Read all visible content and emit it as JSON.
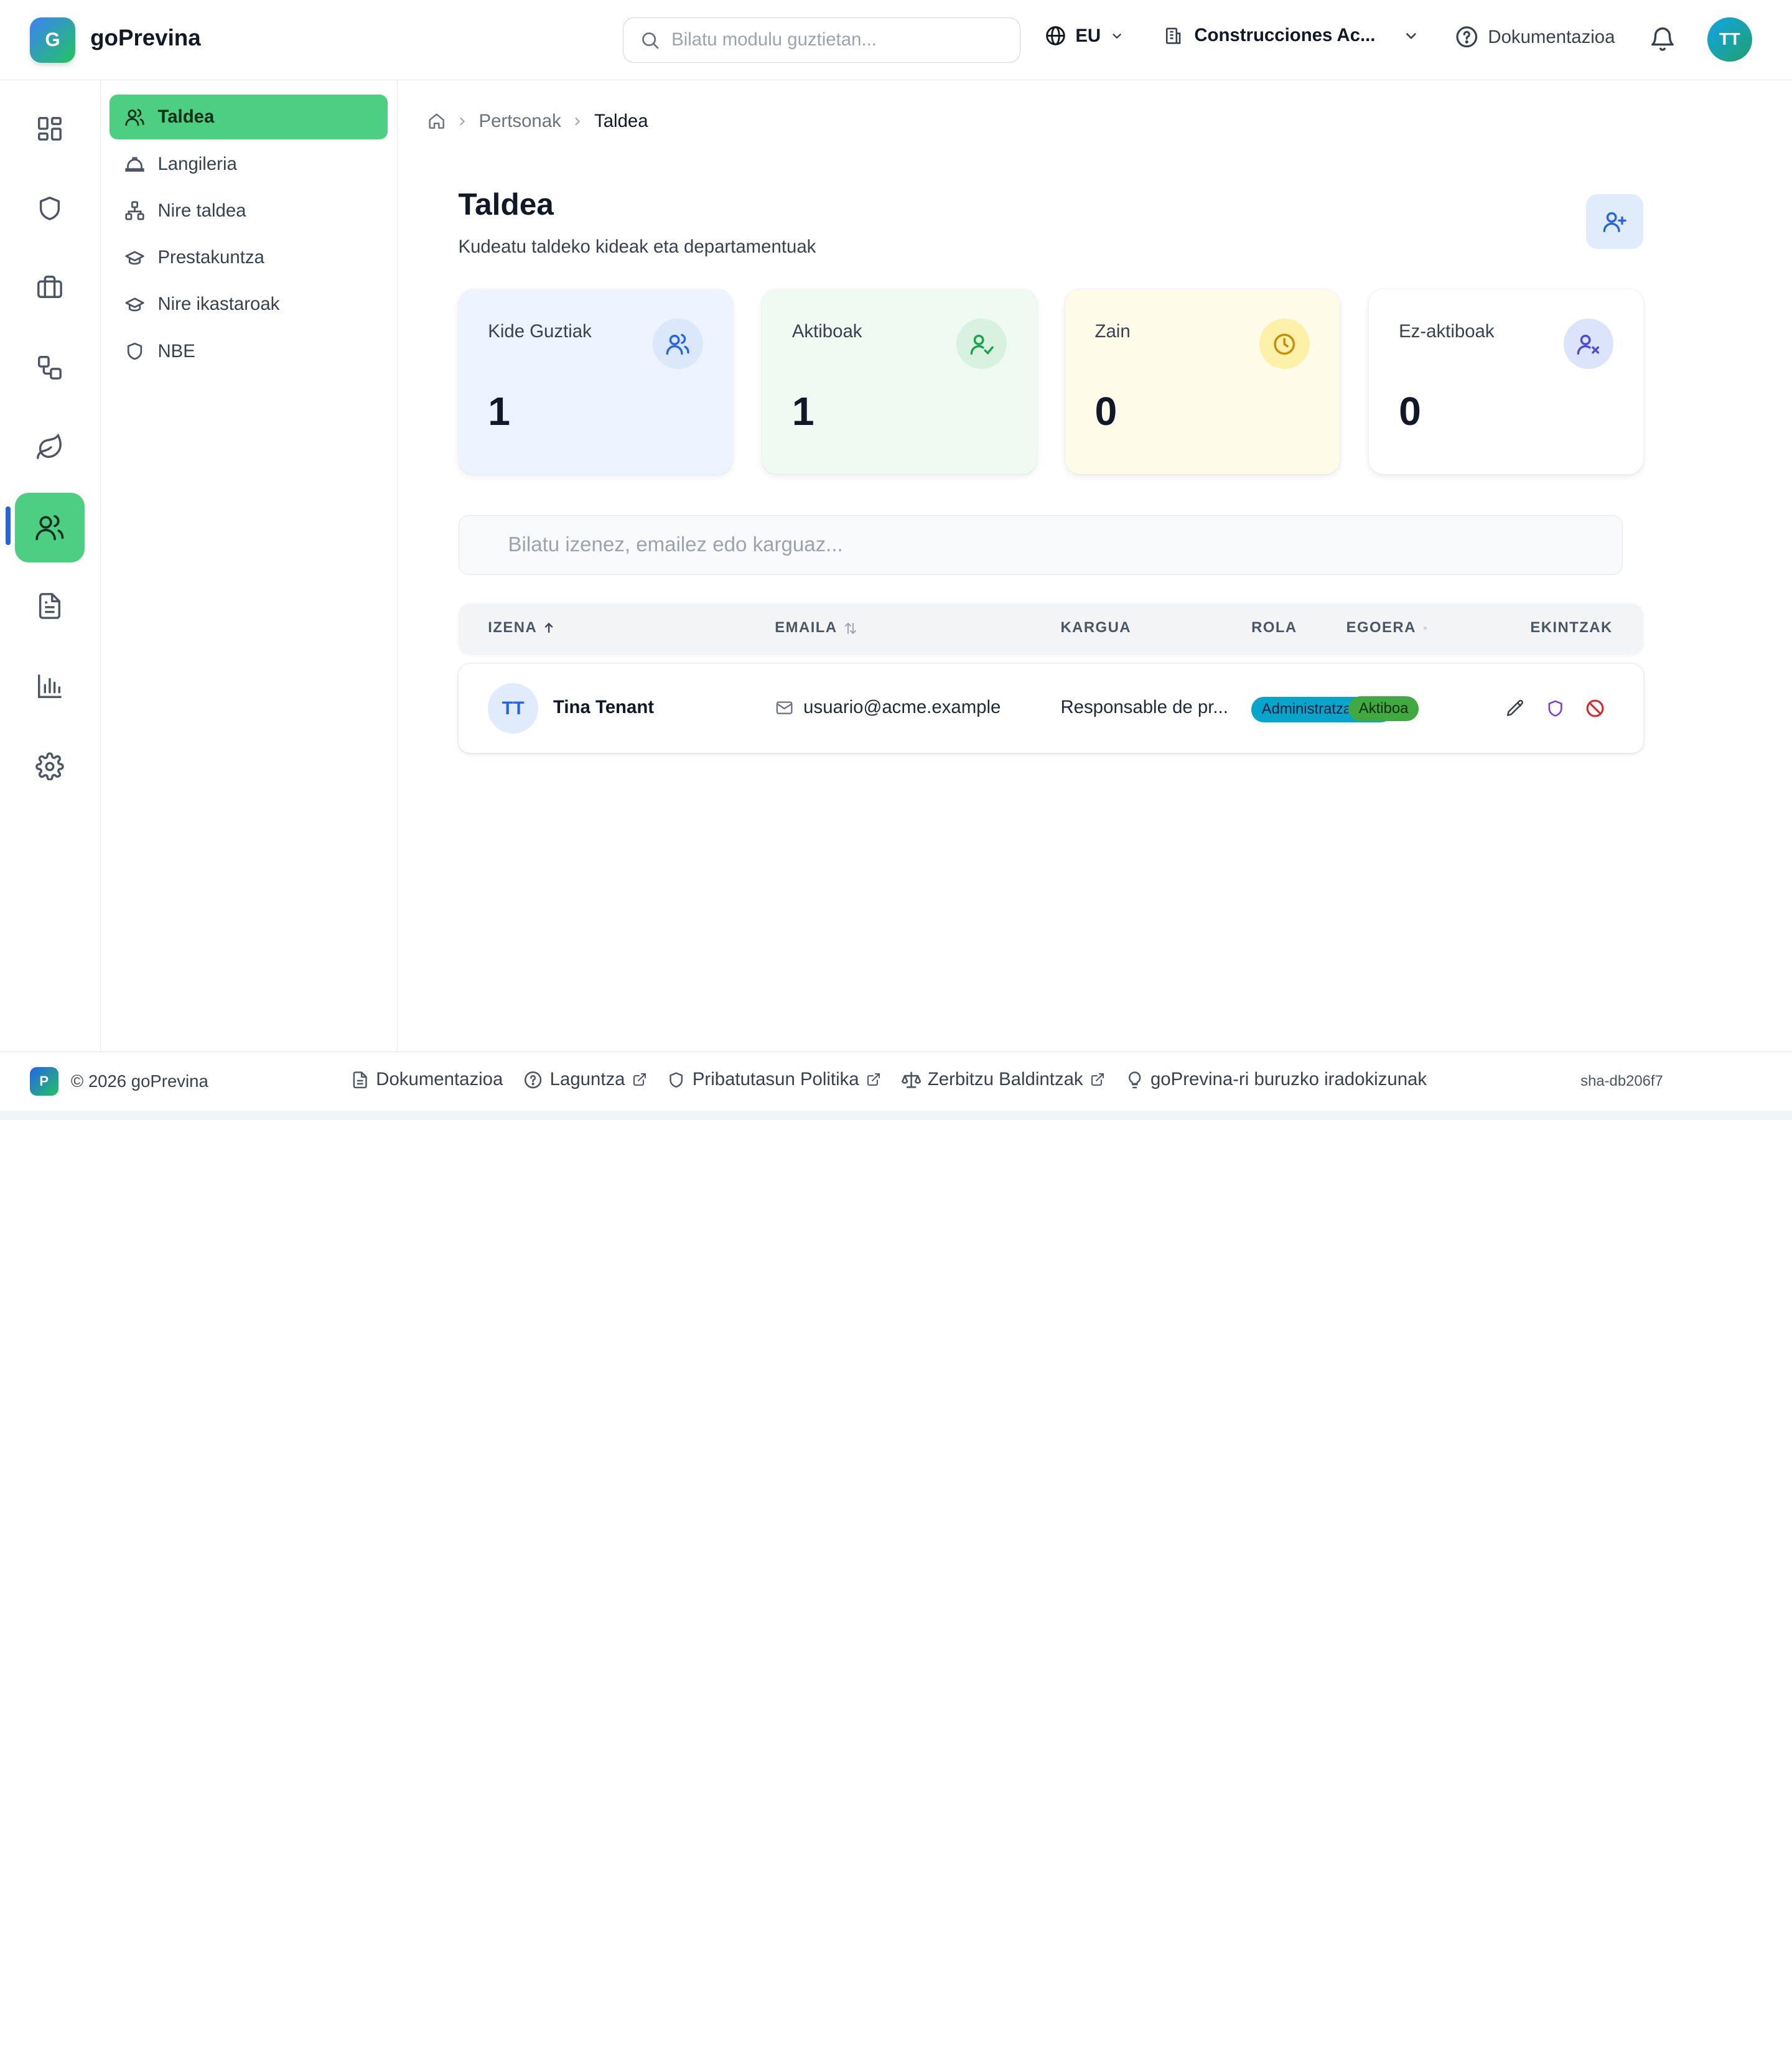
{
  "header": {
    "logo_letter": "G",
    "app_name": "goPrevina",
    "search_placeholder": "Bilatu modulu guztietan...",
    "language": "EU",
    "company": "Construcciones Ac...",
    "docs_label": "Dokumentazioa",
    "user_initials": "TT"
  },
  "rail": {
    "items": [
      "dashboard-icon",
      "shield-icon",
      "briefcase-icon",
      "workflow-icon",
      "leaf-icon",
      "users-icon",
      "document-icon",
      "chart-icon",
      "settings-icon"
    ],
    "active": "users-icon"
  },
  "submenu": {
    "items": [
      {
        "label": "Taldea",
        "icon": "users-icon",
        "active": true
      },
      {
        "label": "Langileria",
        "icon": "hardhat-icon"
      },
      {
        "label": "Nire taldea",
        "icon": "org-chart-icon"
      },
      {
        "label": "Prestakuntza",
        "icon": "graduation-cap-icon"
      },
      {
        "label": "Nire ikastaroak",
        "icon": "graduation-cap-icon"
      },
      {
        "label": "NBE",
        "icon": "shield-icon"
      }
    ]
  },
  "breadcrumb": {
    "parent": "Pertsonak",
    "current": "Taldea"
  },
  "page": {
    "title": "Taldea",
    "subtitle": "Kudeatu taldeko kideak eta departamentuak"
  },
  "stats": [
    {
      "label": "Kide Guztiak",
      "value": "1",
      "bg": "#eef4ff",
      "icon_bg": "#dbe7fb",
      "icon_color": "#2563eb"
    },
    {
      "label": "Aktiboak",
      "value": "1",
      "bg": "#effbf2",
      "icon_bg": "#d9f2df",
      "icon_color": "#16a34a"
    },
    {
      "label": "Zain",
      "value": "0",
      "bg": "#fefce8",
      "icon_bg": "#fdf0a8",
      "icon_color": "#ca8a04"
    },
    {
      "label": "Ez-aktiboak",
      "value": "0",
      "bg": "#ffffff",
      "icon_bg": "#dbe4fb",
      "icon_color": "#4f46e5"
    }
  ],
  "table": {
    "search_placeholder": "Bilatu izenez, emailez edo karguaz...",
    "columns": {
      "name": "IZENA",
      "email": "EMAILA",
      "position": "KARGUA",
      "role": "ROLA",
      "status": "EGOERA",
      "actions": "EKINTZAK"
    },
    "rows": [
      {
        "initials": "TT",
        "name": "Tina Tenant",
        "email": "usuario@acme.example",
        "position": "Responsable de pr...",
        "role": "Administratzailea",
        "status": "Aktiboa"
      }
    ]
  },
  "footer": {
    "logo_letter": "P",
    "copyright": "© 2026 goPrevina",
    "links": [
      "Dokumentazioa",
      "Laguntza",
      "Pribatutasun Politika",
      "Zerbitzu Baldintzak",
      "goPrevina-ri buruzko iradokizunak"
    ],
    "build": "sha-db206f7"
  },
  "colors": {
    "accent_green": "#4ccf83",
    "active_indicator": "#2563eb",
    "role_badge": "#06a5cc",
    "status_badge": "#3faa3f"
  }
}
